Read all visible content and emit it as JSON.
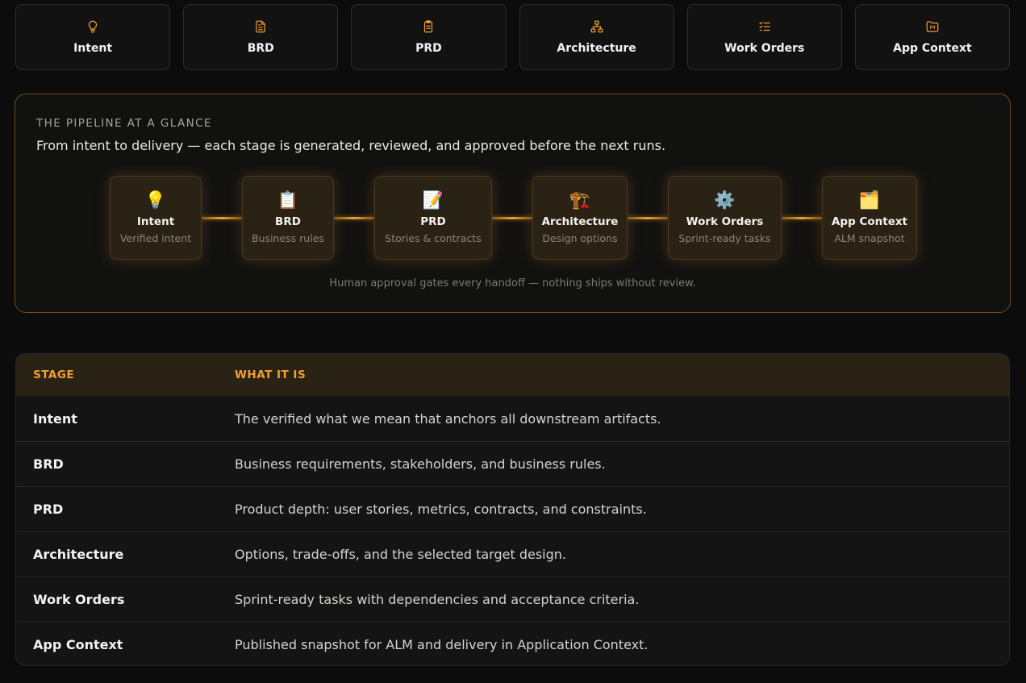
{
  "tabs": [
    {
      "label": "Intent",
      "icon": "lightbulb-icon"
    },
    {
      "label": "BRD",
      "icon": "document-icon"
    },
    {
      "label": "PRD",
      "icon": "clipboard-icon"
    },
    {
      "label": "Architecture",
      "icon": "hierarchy-icon"
    },
    {
      "label": "Work Orders",
      "icon": "checklist-icon"
    },
    {
      "label": "App Context",
      "icon": "folder-icon"
    }
  ],
  "pipeline": {
    "eyebrow": "THE PIPELINE AT A GLANCE",
    "subtitle": "From intent to delivery — each stage is generated, reviewed, and approved before the next runs.",
    "stages": [
      {
        "title": "Intent",
        "sub": "Verified intent",
        "emoji": "💡"
      },
      {
        "title": "BRD",
        "sub": "Business rules",
        "emoji": "📋"
      },
      {
        "title": "PRD",
        "sub": "Stories & contracts",
        "emoji": "📝"
      },
      {
        "title": "Architecture",
        "sub": "Design options",
        "emoji": "🏗️"
      },
      {
        "title": "Work Orders",
        "sub": "Sprint-ready tasks",
        "emoji": "⚙️"
      },
      {
        "title": "App Context",
        "sub": "ALM snapshot",
        "emoji": "🗂️"
      }
    ],
    "footnote": "Human approval gates every handoff — nothing ships without review."
  },
  "table": {
    "headers": [
      "STAGE",
      "WHAT IT IS"
    ],
    "rows": [
      {
        "stage": "Intent",
        "desc": "The verified what we mean that anchors all downstream artifacts."
      },
      {
        "stage": "BRD",
        "desc": "Business requirements, stakeholders, and business rules."
      },
      {
        "stage": "PRD",
        "desc": "Product depth: user stories, metrics, contracts, and constraints."
      },
      {
        "stage": "Architecture",
        "desc": "Options, trade-offs, and the selected target design."
      },
      {
        "stage": "Work Orders",
        "desc": "Sprint-ready tasks with dependencies and acceptance criteria."
      },
      {
        "stage": "App Context",
        "desc": "Published snapshot for ALM and delivery in Application Context."
      }
    ]
  },
  "colors": {
    "accent": "#f0a030",
    "background": "#0c0c0c",
    "panel_border": "#6b4f1f"
  }
}
